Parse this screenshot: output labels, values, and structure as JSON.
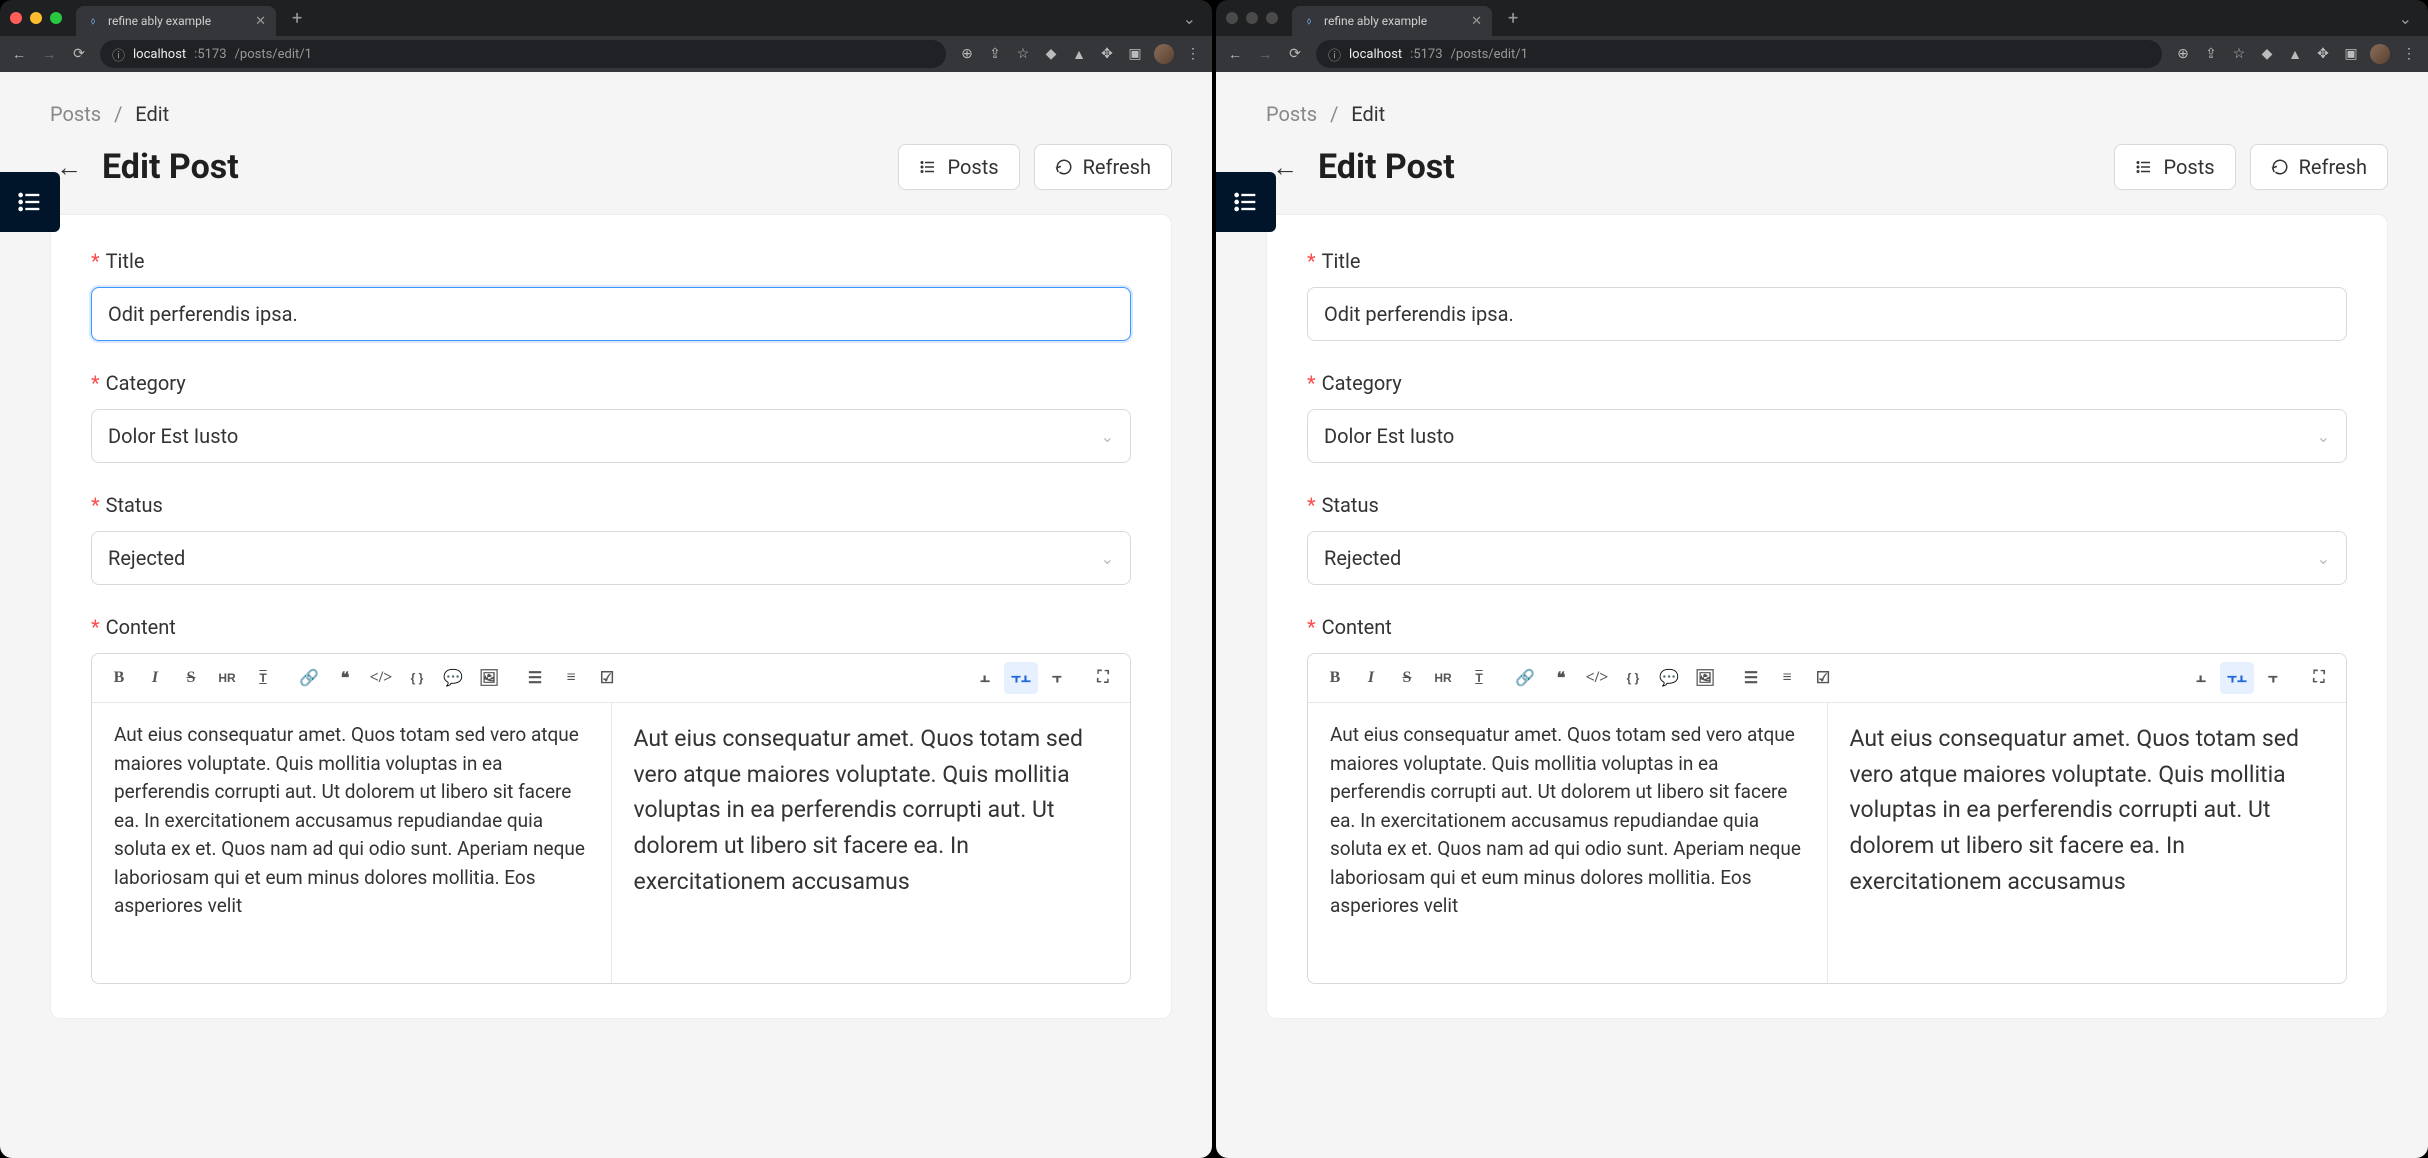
{
  "browser": {
    "tab_title": "refine ably example",
    "url_host": "localhost",
    "url_port": ":5173",
    "url_path": "/posts/edit/1"
  },
  "breadcrumb": {
    "root": "Posts",
    "current": "Edit"
  },
  "header": {
    "title": "Edit Post",
    "posts_btn": "Posts",
    "refresh_btn": "Refresh"
  },
  "form": {
    "title_label": "Title",
    "title_value": "Odit perferendis ipsa.",
    "category_label": "Category",
    "category_value": "Dolor Est Iusto",
    "status_label": "Status",
    "status_value": "Rejected",
    "content_label": "Content",
    "content_raw": "Aut eius consequatur amet. Quos totam sed vero atque maiores voluptate. Quis mollitia voluptas in ea perferendis corrupti aut. Ut dolorem ut libero sit facere ea. In exercitationem accusamus repudiandae quia soluta ex et. Quos nam ad qui odio sunt. Aperiam neque laboriosam qui et eum minus dolores mollitia. Eos asperiores velit",
    "content_preview": "Aut eius consequatur amet. Quos totam sed vero atque maiores voluptate. Quis mollitia voluptas in ea perferendis corrupti aut. Ut dolorem ut libero sit facere ea. In exercitationem accusamus"
  },
  "panes": {
    "left_title_focused": true,
    "right_title_focused": false
  }
}
